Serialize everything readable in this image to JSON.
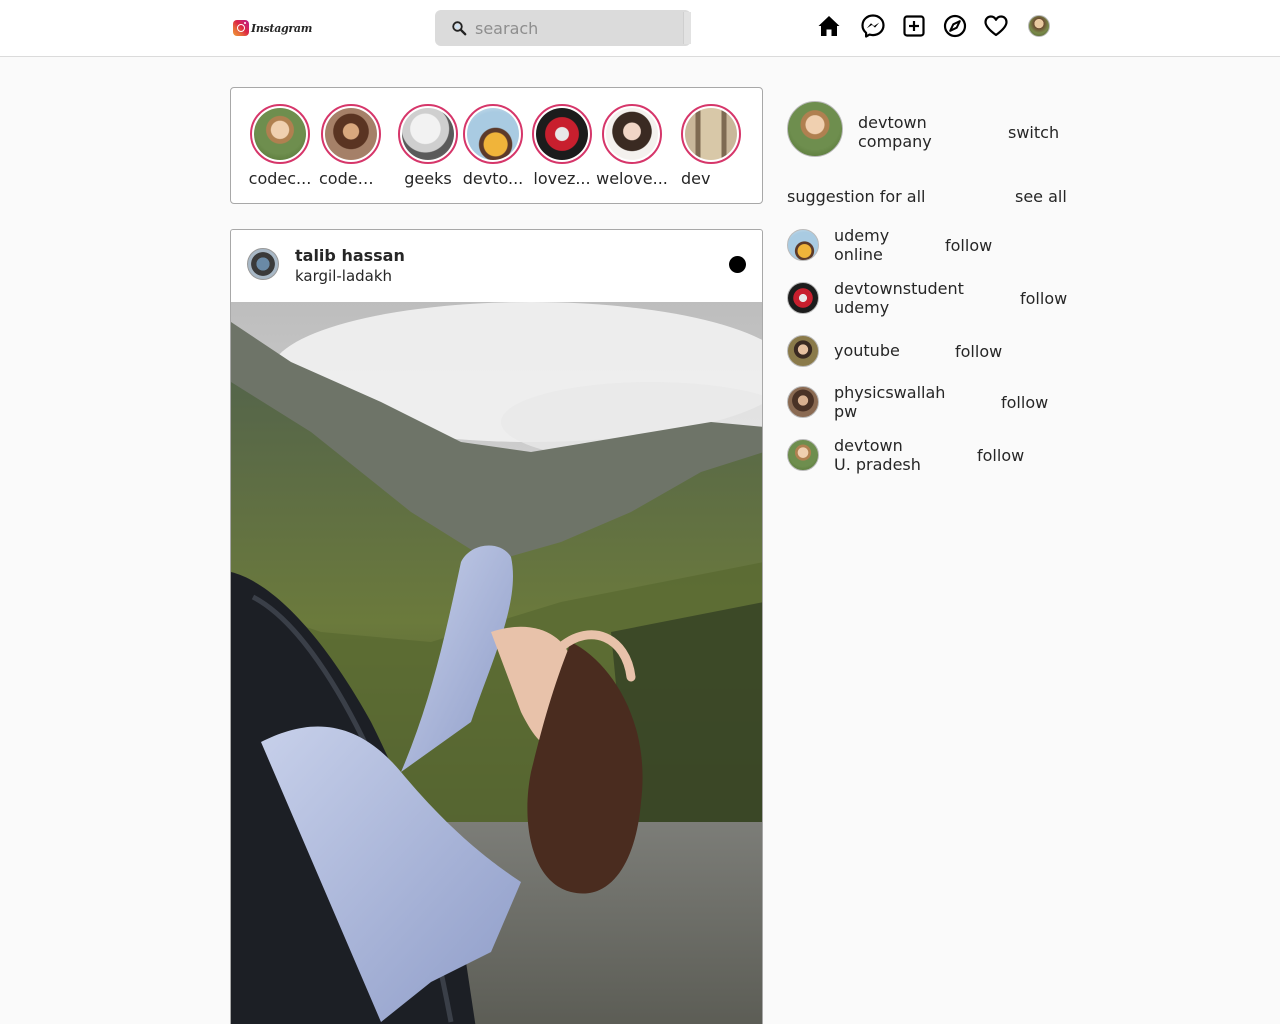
{
  "app": {
    "logo_text": "Instagram"
  },
  "search": {
    "placeholder": "searach"
  },
  "nav": {
    "icons": [
      "home-icon",
      "messenger-icon",
      "new-post-icon",
      "explore-icon",
      "activity-heart-icon",
      "profile-avatar"
    ]
  },
  "stories": [
    {
      "name": "codecamp",
      "display": "codec..."
    },
    {
      "name": "codeninja",
      "display": "codeni..."
    },
    {
      "name": "geeks",
      "display": "geeks"
    },
    {
      "name": "devtown",
      "display": "devto..."
    },
    {
      "name": "lovez",
      "display": "lovez..."
    },
    {
      "name": "welove",
      "display": "welove..."
    },
    {
      "name": "dev",
      "display": "dev"
    }
  ],
  "post": {
    "username": "talib hassan",
    "location": "kargil-ladakh"
  },
  "sidebar": {
    "me": {
      "name_line1": "devtown",
      "name_line2": "company",
      "switch_label": "switch"
    },
    "suggestion_title": "suggestion for all",
    "see_all_label": "see all",
    "follow_label": "follow",
    "suggestions": [
      {
        "line1": "udemy",
        "line2": "online"
      },
      {
        "line1": "devtownstudent",
        "line2": "udemy"
      },
      {
        "line1": "youtube",
        "line2": ""
      },
      {
        "line1": "physicswallah",
        "line2": "pw"
      },
      {
        "line1": "devtown",
        "line2": "U. pradesh"
      }
    ]
  },
  "colors": {
    "story_ring": "#d6366a",
    "border": "#a8a8a8",
    "background": "#fafafa"
  }
}
